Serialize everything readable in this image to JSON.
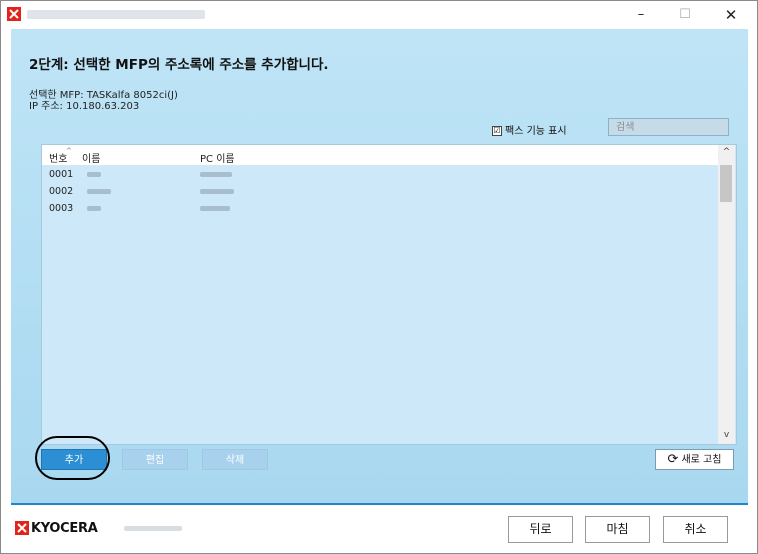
{
  "window": {
    "controls": {
      "minimize": "–",
      "maximize": "☐",
      "close": "✕"
    }
  },
  "heading": "2단계: 선택한 MFP의 주소록에 주소를 추가합니다.",
  "mfp_info": {
    "selected": "선택한 MFP: TASKalfa 8052ci(J)",
    "ip": "IP 주소: 10.180.63.203"
  },
  "fax_toggle": {
    "checked": true,
    "label": "팩스 기능 표시",
    "check_glyph": "☑"
  },
  "search": {
    "placeholder": "검색",
    "value": ""
  },
  "table": {
    "columns": [
      "번호",
      "이름",
      "PC 이름"
    ],
    "sort_glyph": "^",
    "rows": [
      {
        "number": "0001"
      },
      {
        "number": "0002"
      },
      {
        "number": "0003"
      }
    ]
  },
  "scrollbar": {
    "up": "^",
    "down": "v"
  },
  "actions": {
    "add": "추가",
    "edit": "편집",
    "delete": "삭제"
  },
  "refresh": {
    "icon": "refresh-icon",
    "glyph": "⟳",
    "label": "새로 고침"
  },
  "footer": {
    "logo_text": "KYOCERA",
    "back": "뒤로",
    "finish": "마침",
    "cancel": "취소"
  },
  "colors": {
    "accent": "#2d8fd3",
    "client_bg": "#b6def4",
    "disabled_button": "#a8d1ee",
    "brand_red": "#e2231a"
  }
}
